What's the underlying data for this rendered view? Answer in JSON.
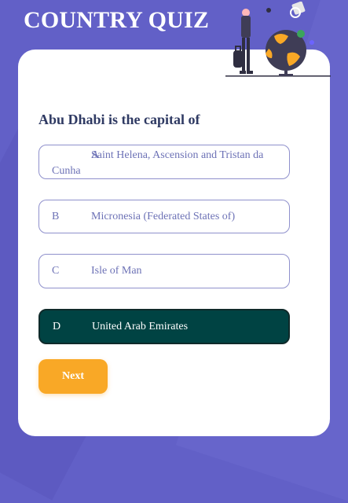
{
  "app": {
    "title": "COUNTRY QUIZ",
    "illustration_icon": "traveler-with-globe-icon"
  },
  "quiz": {
    "question": "Abu Dhabi is the capital of",
    "options": [
      {
        "letter": "A",
        "text": "Saint Helena, Ascension and Tristan da Cunha",
        "selected": false
      },
      {
        "letter": "B",
        "text": "Micronesia (Federated States of)",
        "selected": false
      },
      {
        "letter": "C",
        "text": "Isle of Man",
        "selected": false
      },
      {
        "letter": "D",
        "text": "United Arab Emirates",
        "selected": true
      }
    ],
    "next_label": "Next"
  },
  "colors": {
    "background": "#6260c7",
    "card": "#ffffff",
    "question_text": "#2f3a63",
    "option_border": "#8f90cc",
    "option_text": "#6d72b6",
    "selected_option_bg": "#004343",
    "next_button": "#f9a826"
  }
}
